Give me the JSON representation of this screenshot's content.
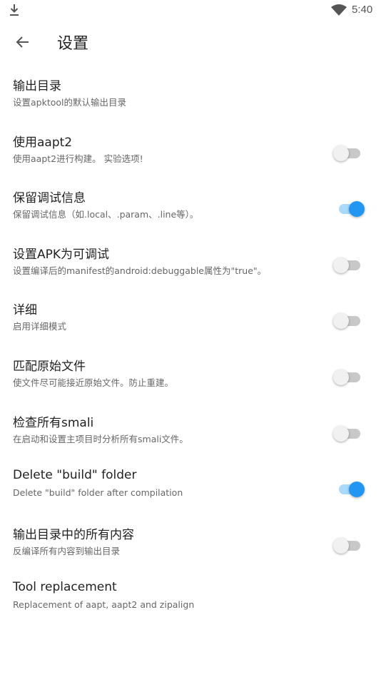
{
  "status_bar": {
    "time": "5:40",
    "download_icon": "download-icon",
    "wifi_icon": "wifi-icon"
  },
  "app_bar": {
    "back_icon": "arrow-back-icon",
    "title": "设置"
  },
  "settings": [
    {
      "title": "输出目录",
      "summary": "设置apktool的默认输出目录",
      "has_switch": false
    },
    {
      "title": "使用aapt2",
      "summary": "使用aapt2进行构建。 实验选项!",
      "has_switch": true,
      "checked": false
    },
    {
      "title": "保留调试信息",
      "summary": "保留调试信息（如.local、.param、.line等）。",
      "has_switch": true,
      "checked": true
    },
    {
      "title": "设置APK为可调试",
      "summary": "设置编译后的manifest的android:debuggable属性为\"true\"。",
      "has_switch": true,
      "checked": false
    },
    {
      "title": "详细",
      "summary": "启用详细模式",
      "has_switch": true,
      "checked": false
    },
    {
      "title": "匹配原始文件",
      "summary": "使文件尽可能接近原始文件。防止重建。",
      "has_switch": true,
      "checked": false
    },
    {
      "title": "检查所有smali",
      "summary": "在启动和设置主项目时分析所有smali文件。",
      "has_switch": true,
      "checked": false
    },
    {
      "title": "Delete \"build\" folder",
      "summary": "Delete \"build\" folder after compilation",
      "has_switch": true,
      "checked": true
    },
    {
      "title": "输出目录中的所有内容",
      "summary": "反编译所有内容到输出目录",
      "has_switch": true,
      "checked": false
    },
    {
      "title": "Tool replacement",
      "summary": "Replacement of aapt, aapt2 and zipalign",
      "has_switch": false
    }
  ],
  "colors": {
    "accent": "#2196f3",
    "accent_track": "#a9dafb",
    "switch_off_track": "#c8c8c8"
  }
}
